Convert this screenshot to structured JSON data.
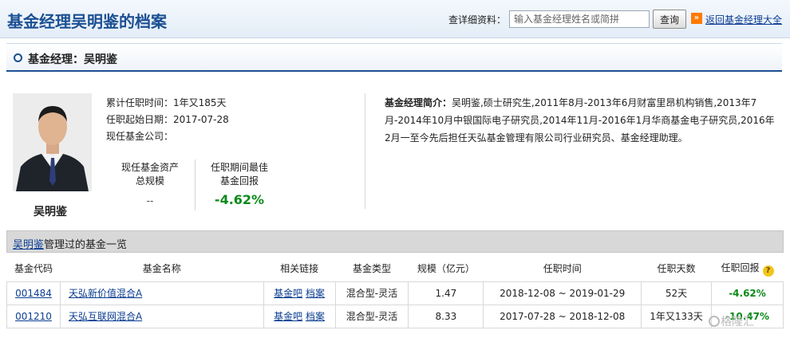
{
  "header": {
    "title": "基金经理吴明鉴的档案",
    "search_label": "查详细资料：",
    "search_placeholder": "输入基金经理姓名或简拼",
    "query_button": "查询",
    "back_link": "返回基金经理大全"
  },
  "section": {
    "title": "基金经理：吴明鉴"
  },
  "profile": {
    "name": "吴明鉴",
    "tenure_label": "累计任职时间：",
    "tenure_value": "1年又185天",
    "start_label": "任职起始日期：",
    "start_value": "2017-07-28",
    "company_label": "现任基金公司：",
    "company_value": "",
    "assets_label_line1": "现任基金资产",
    "assets_label_line2": "总规模",
    "assets_value": "--",
    "best_return_label_line1": "任职期间最佳",
    "best_return_label_line2": "基金回报",
    "best_return_value": "-4.62%"
  },
  "bio": {
    "label": "基金经理简介：",
    "text": "吴明鉴,硕士研究生,2011年8月-2013年6月财富里昂机构销售,2013年7月-2014年10月中银国际电子研究员,2014年11月-2016年1月华商基金电子研究员,2016年2月一至今先后担任天弘基金管理有限公司行业研究员、基金经理助理。"
  },
  "fund_list": {
    "title_link": "吴明鉴",
    "title_suffix": "管理过的基金一览",
    "columns": [
      "基金代码",
      "基金名称",
      "相关链接",
      "基金类型",
      "规模（亿元）",
      "任职时间",
      "任职天数",
      "任职回报"
    ],
    "rows": [
      {
        "code": "001484",
        "name": "天弘新价值混合A",
        "link1": "基金吧",
        "link2": "档案",
        "type": "混合型-灵活",
        "scale": "1.47",
        "period": "2018-12-08 ~ 2019-01-29",
        "days": "52天",
        "return": "-4.62%"
      },
      {
        "code": "001210",
        "name": "天弘互联网混合A",
        "link1": "基金吧",
        "link2": "档案",
        "type": "混合型-灵活",
        "scale": "8.33",
        "period": "2017-07-28 ~ 2018-12-08",
        "days": "1年又133天",
        "return": "-10.47%"
      }
    ]
  },
  "watermark": "格隆汇",
  "colors": {
    "title_blue": "#1b4f93",
    "link_blue": "#0b3d91",
    "positive_green": "#0a8a1a",
    "accent_orange": "#ff7a00"
  }
}
